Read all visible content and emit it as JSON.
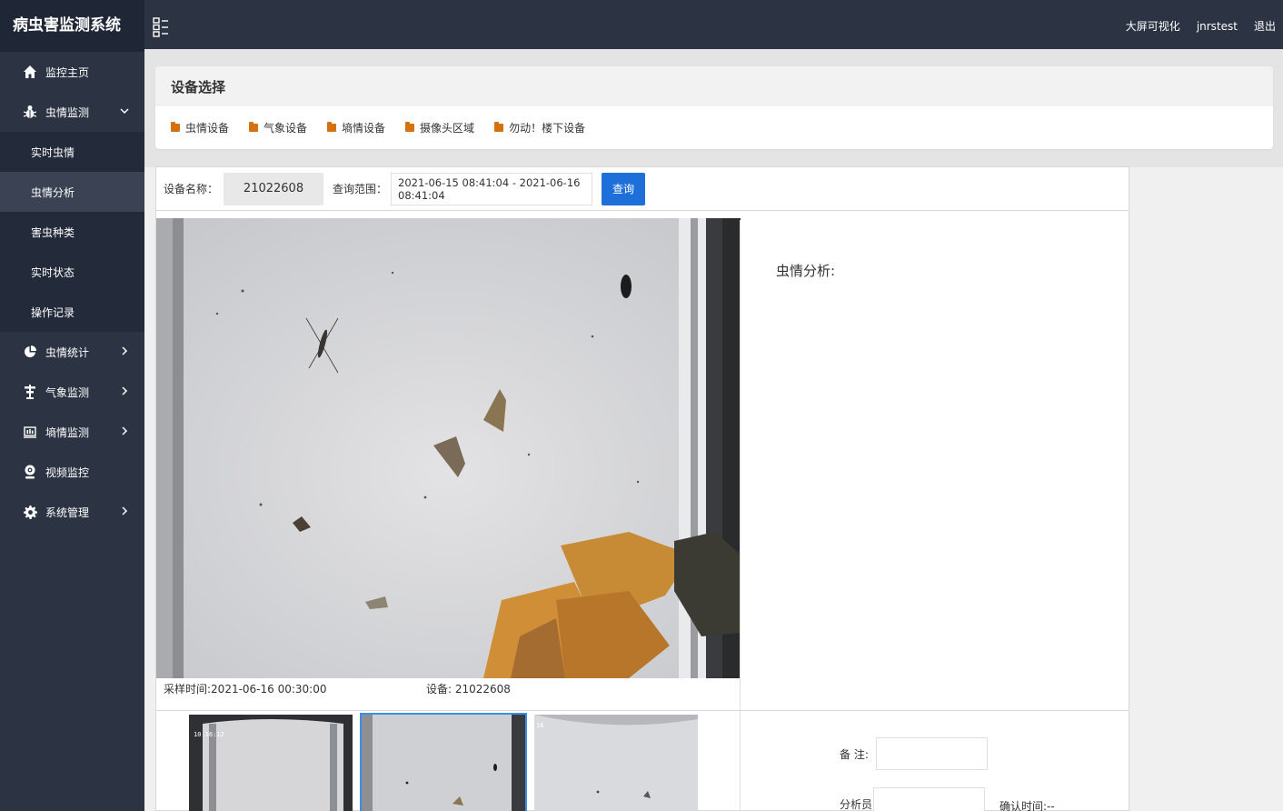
{
  "app": {
    "title": "病虫害监测系统",
    "header_links": [
      "大屏可视化",
      "jnrstest",
      "退出"
    ]
  },
  "sidebar": {
    "items": [
      {
        "label": "监控主页",
        "icon": "home-icon",
        "has_children": false
      },
      {
        "label": "虫情监测",
        "icon": "bug-icon",
        "has_children": true,
        "expanded": true,
        "children": [
          {
            "label": "实时虫情",
            "active": false
          },
          {
            "label": "虫情分析",
            "active": true
          },
          {
            "label": "害虫种类",
            "active": false
          },
          {
            "label": "实时状态",
            "active": false
          },
          {
            "label": "操作记录",
            "active": false
          }
        ]
      },
      {
        "label": "虫情统计",
        "icon": "pie-chart-icon",
        "has_children": true
      },
      {
        "label": "气象监测",
        "icon": "weather-station-icon",
        "has_children": true
      },
      {
        "label": "墒情监测",
        "icon": "soil-sensor-icon",
        "has_children": true
      },
      {
        "label": "视频监控",
        "icon": "camera-icon",
        "has_children": false
      },
      {
        "label": "系统管理",
        "icon": "gear-icon",
        "has_children": true
      }
    ]
  },
  "device_select": {
    "title": "设备选择",
    "tabs": [
      "虫情设备",
      "气象设备",
      "墒情设备",
      "摄像头区域",
      "勿动！楼下设备"
    ]
  },
  "query": {
    "device_label": "设备名称：",
    "device_value": "21022608",
    "range_label": "查询范围：",
    "range_value": "2021-06-15 08:41:04 - 2021-06-16 08:41:04",
    "button": "查询"
  },
  "photo": {
    "sample_time": "采样时间:2021-06-16 00:30:00",
    "device": "设备: 21022608"
  },
  "analysis": {
    "title": "虫情分析:"
  },
  "thumbnails": [
    {
      "stamp": "10:16:12",
      "selected": false
    },
    {
      "stamp": "",
      "selected": true
    },
    {
      "stamp": "16",
      "selected": false
    }
  ],
  "review": {
    "note_label": "备 注:",
    "note_value": "",
    "analyst_label": "分析员:",
    "analyst_value": "",
    "confirm_time": "确认时间:--"
  },
  "colors": {
    "sidebar_bg": "#2c3444",
    "sidebar_active": "#3a4254",
    "folder_icon": "#d4720f",
    "primary_button": "#1e6fd9"
  }
}
